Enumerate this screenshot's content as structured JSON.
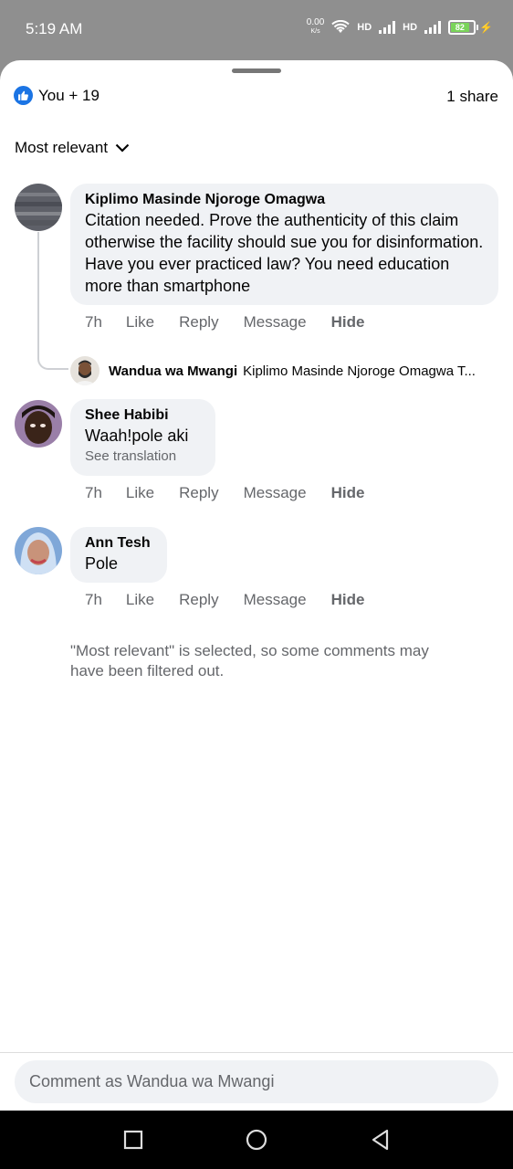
{
  "status_bar": {
    "time": "5:19 AM",
    "net_speed": "0.00",
    "net_speed_unit": "K/s",
    "sim1_label": "HD",
    "sim2_label": "HD",
    "battery_level": "82"
  },
  "header": {
    "reaction_icon": "like-icon",
    "reactions_text": "You + 19",
    "shares_text": "1 share"
  },
  "sort": {
    "label": "Most relevant",
    "icon": "chevron-down-icon"
  },
  "comments": [
    {
      "author": "Kiplimo Masinde Njoroge Omagwa",
      "text": "Citation needed. Prove the authenticity of this claim otherwise the facility should sue you for disinformation. Have you ever practiced law? You need education more than smartphone",
      "time": "7h",
      "like": "Like",
      "reply": "Reply",
      "message": "Message",
      "hide": "Hide",
      "reply_preview": {
        "author": "Wandua wa Mwangi",
        "text": "Kiplimo Masinde Njoroge Omagwa  T..."
      }
    },
    {
      "author": "Shee Habibi",
      "text": "Waah!pole aki",
      "see_translation": "See translation",
      "time": "7h",
      "like": "Like",
      "reply": "Reply",
      "message": "Message",
      "hide": "Hide"
    },
    {
      "author": "Ann Tesh",
      "text": "Pole",
      "time": "7h",
      "like": "Like",
      "reply": "Reply",
      "message": "Message",
      "hide": "Hide"
    }
  ],
  "filter_note": "\"Most relevant\" is selected, so some comments may have been filtered out.",
  "composer": {
    "placeholder": "Comment as Wandua wa Mwangi"
  },
  "colors": {
    "accent": "#1b74e4",
    "bubble": "#f0f2f5",
    "secondary_text": "#65676b"
  }
}
